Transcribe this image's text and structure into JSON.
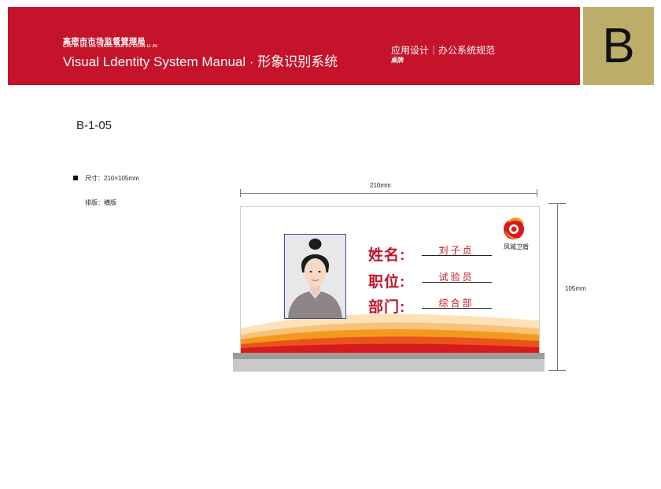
{
  "header": {
    "org_cn": "高密市市场监督管理局",
    "org_pinyin": "GAO MI SHI SHI CHANG JIAN DU GUAN LI JU",
    "manual_title": "Visual Ldentity System Manual · 形象识别系统",
    "section_title": "应用设计｜办公系统规范",
    "section_sub": "桌牌",
    "chapter_letter": "B"
  },
  "page_code": "B-1-05",
  "specs": {
    "size": "尺寸：210×105mm",
    "layout": "排版：横版"
  },
  "dimensions": {
    "width_label": "210mm",
    "height_label": "105mm"
  },
  "nameplate": {
    "fields": [
      {
        "label": "姓名:",
        "value": "刘子贞"
      },
      {
        "label": "职位:",
        "value": "试验员"
      },
      {
        "label": "部门:",
        "value": "综合部"
      }
    ],
    "logo_caption": "凤城卫盾"
  },
  "colors": {
    "brand_red": "#c4132a",
    "accent_gold": "#bcae68",
    "wave_orange": "#f39a1e"
  }
}
